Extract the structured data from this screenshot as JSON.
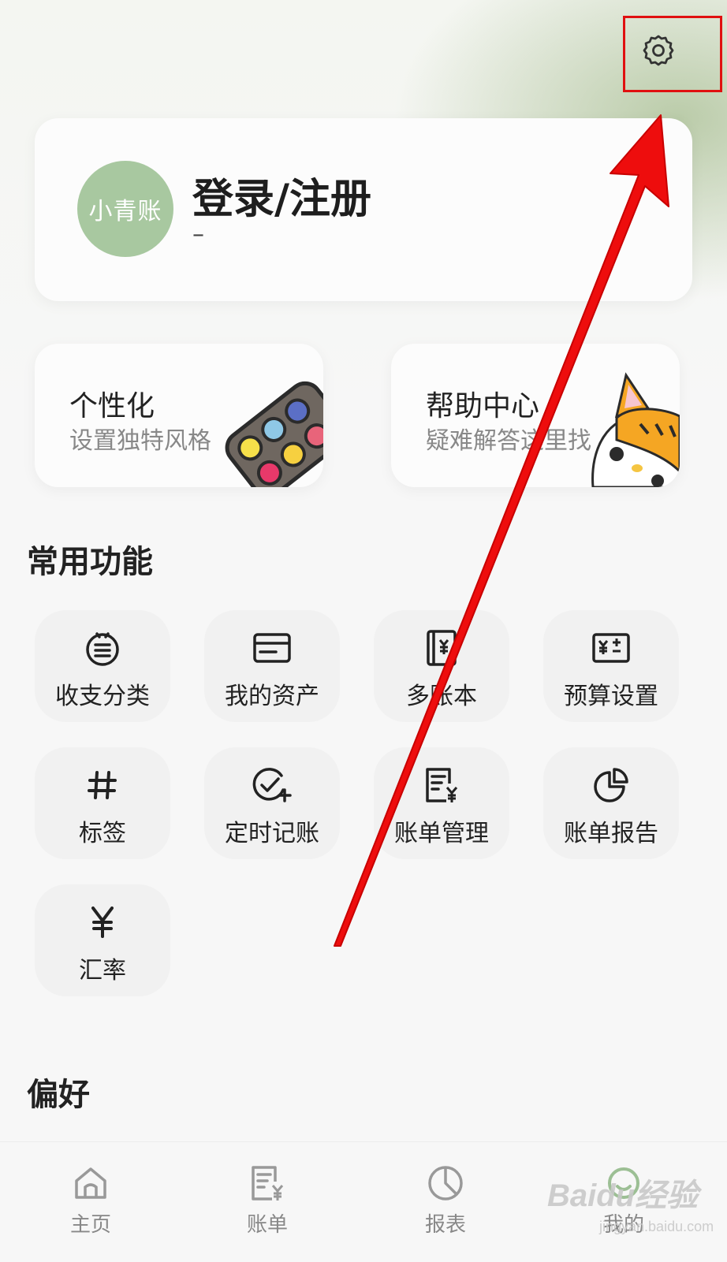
{
  "header": {
    "settings_icon": "gear-icon"
  },
  "profile": {
    "avatar_text": "小青账",
    "title": "登录/注册",
    "subtitle": "–"
  },
  "features": [
    {
      "title": "个性化",
      "subtitle": "设置独特风格",
      "icon": "palette-illustration"
    },
    {
      "title": "帮助中心",
      "subtitle": "疑难解答这里找",
      "icon": "cat-illustration"
    }
  ],
  "common": {
    "title": "常用功能",
    "items": [
      {
        "label": "收支分类",
        "icon": "category-icon"
      },
      {
        "label": "我的资产",
        "icon": "card-icon"
      },
      {
        "label": "多账本",
        "icon": "ledger-icon"
      },
      {
        "label": "预算设置",
        "icon": "budget-icon"
      },
      {
        "label": "标签",
        "icon": "hashtag-icon"
      },
      {
        "label": "定时记账",
        "icon": "scheduled-check-icon"
      },
      {
        "label": "账单管理",
        "icon": "bill-manage-icon"
      },
      {
        "label": "账单报告",
        "icon": "pie-chart-icon"
      },
      {
        "label": "汇率",
        "icon": "yen-icon"
      }
    ]
  },
  "preferences": {
    "title": "偏好"
  },
  "bottom_nav": {
    "items": [
      {
        "label": "主页",
        "icon": "home-icon"
      },
      {
        "label": "账单",
        "icon": "bill-icon"
      },
      {
        "label": "报表",
        "icon": "report-icon"
      },
      {
        "label": "我的",
        "icon": "profile-icon"
      }
    ]
  },
  "watermark": {
    "brand": "Baidu经验",
    "url": "jingyan.baidu.com"
  },
  "colors": {
    "accent_green": "#a8c8a0",
    "annotation_red": "#e01010"
  }
}
